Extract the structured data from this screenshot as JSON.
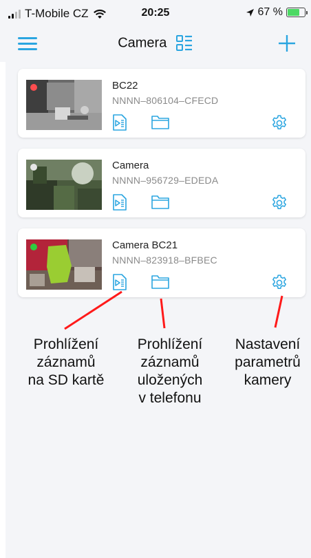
{
  "status_bar": {
    "carrier": "T-Mobile CZ",
    "time": "20:25",
    "battery_percent": "67 %",
    "battery_level": 0.67
  },
  "header": {
    "title": "Camera",
    "menu_icon": "hamburger-menu-icon",
    "layout_icon": "grid-list-icon",
    "add_icon": "plus-icon",
    "accent_color": "#2aa5e0"
  },
  "cameras": [
    {
      "name": "BC22",
      "uid": "NNNN–806104–CFECD",
      "status_color": "#ff4d4f"
    },
    {
      "name": "Camera",
      "uid": "NNNN–956729–EDEDA",
      "status_color": "#e6e6e6"
    },
    {
      "name": "Camera BC21",
      "uid": "NNNN–823918–BFBEC",
      "status_color": "#2ecc40"
    }
  ],
  "annotations": [
    {
      "lines": [
        "Prohlížení",
        "záznamů",
        "na SD kartě"
      ]
    },
    {
      "lines": [
        "Prohlížení",
        "záznamů",
        "uložených",
        "v telefonu"
      ]
    },
    {
      "lines": [
        "Nastavení",
        "parametrů",
        "kamery"
      ]
    }
  ]
}
